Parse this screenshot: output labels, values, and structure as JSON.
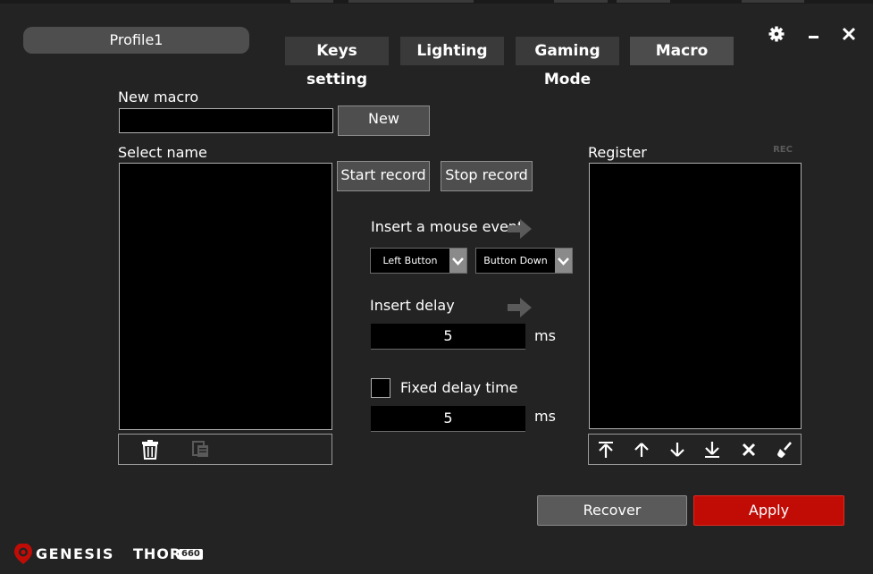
{
  "header": {
    "profile_name": "Profile1",
    "tabs": [
      "Keys setting",
      "Lighting",
      "Gaming Mode",
      "Macro"
    ],
    "active_tab": "Macro"
  },
  "window_controls": {
    "settings_icon": "gear-icon",
    "minimize_icon": "minimize-icon",
    "close_icon": "close-icon"
  },
  "macro": {
    "new_macro_label": "New macro",
    "new_macro_value": "",
    "new_button": "New",
    "select_name_label": "Select name",
    "start_record": "Start record",
    "stop_record": "Stop record",
    "insert_mouse_event_label": "Insert a mouse event",
    "mouse_button_selected": "Left Button",
    "mouse_action_selected": "Button Down",
    "insert_delay_label": "Insert delay",
    "insert_delay_value": "5",
    "ms_unit": "ms",
    "fixed_delay_label": "Fixed delay time",
    "fixed_delay_checked": false,
    "fixed_delay_value": "5",
    "register_label": "Register",
    "rec_badge": "REC",
    "list_toolbar_icons": [
      "trash-icon",
      "copy-icon"
    ],
    "register_toolbar_icons": [
      "move-top-icon",
      "move-up-icon",
      "move-down-icon",
      "move-bottom-icon",
      "delete-icon",
      "clear-icon"
    ]
  },
  "footer": {
    "recover_button": "Recover",
    "apply_button": "Apply",
    "brand": "GENESIS",
    "product": "THOR",
    "product_badge": "660"
  },
  "colors": {
    "background": "#232323",
    "apply": "#c10c06",
    "tab_active": "#4c4c4c"
  }
}
